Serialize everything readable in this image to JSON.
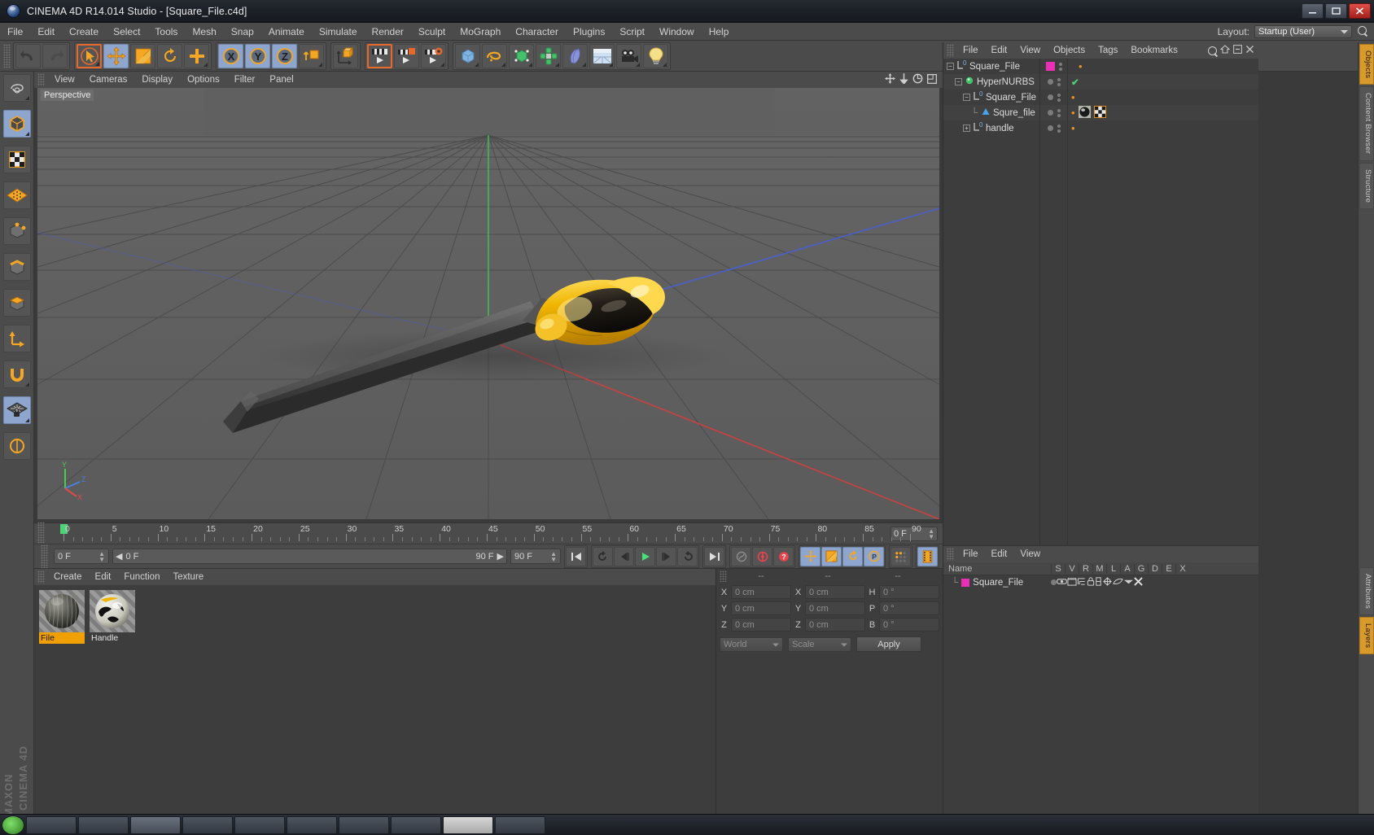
{
  "window": {
    "title": "CINEMA 4D R14.014 Studio - [Square_File.c4d]",
    "app_icon": "c4d-logo-icon",
    "buttons": {
      "minimize": "minimize-icon",
      "maximize": "maximize-icon",
      "close": "close-icon"
    }
  },
  "menubar": {
    "items": [
      "File",
      "Edit",
      "Create",
      "Select",
      "Tools",
      "Mesh",
      "Snap",
      "Animate",
      "Simulate",
      "Render",
      "Sculpt",
      "MoGraph",
      "Character",
      "Plugins",
      "Script",
      "Window",
      "Help"
    ],
    "layout_label": "Layout:",
    "layout_value": "Startup (User)",
    "search_icon": "search-icon"
  },
  "toolbar": {
    "undo": "undo-icon",
    "redo": "redo-icon",
    "groups": [
      {
        "name": "transform-tools",
        "buttons": [
          {
            "icon": "selection-arrow-icon",
            "state": "selected"
          },
          {
            "icon": "move-tool-icon",
            "state": "active"
          },
          {
            "icon": "scale-tool-icon",
            "state": "normal"
          },
          {
            "icon": "rotate-tool-icon",
            "state": "normal"
          },
          {
            "icon": "add-move-icon",
            "state": "normal"
          }
        ]
      },
      {
        "name": "axis-locks",
        "buttons": [
          {
            "icon": "x-axis-icon",
            "state": "active"
          },
          {
            "icon": "y-axis-icon",
            "state": "active"
          },
          {
            "icon": "z-axis-icon",
            "state": "active"
          },
          {
            "icon": "world-object-axis-icon",
            "state": "active"
          }
        ]
      },
      {
        "name": "coordinate-system",
        "buttons": [
          {
            "icon": "object-axis-icon",
            "state": "normal"
          }
        ]
      },
      {
        "name": "render-tools",
        "buttons": [
          {
            "icon": "render-view-icon",
            "state": "selected"
          },
          {
            "icon": "render-region-icon",
            "state": "normal"
          },
          {
            "icon": "render-settings-icon",
            "state": "normal"
          }
        ]
      },
      {
        "name": "object-tools",
        "buttons": [
          {
            "icon": "cube-primitive-icon",
            "state": "normal"
          },
          {
            "icon": "spline-pen-icon",
            "state": "normal"
          },
          {
            "icon": "hypernurbs-icon",
            "state": "normal"
          },
          {
            "icon": "array-generator-icon",
            "state": "normal"
          },
          {
            "icon": "bend-deformer-icon",
            "state": "normal"
          },
          {
            "icon": "floor-environment-icon",
            "state": "normal"
          },
          {
            "icon": "camera-icon",
            "state": "normal"
          },
          {
            "icon": "light-icon",
            "state": "normal"
          }
        ]
      }
    ]
  },
  "left_palette": {
    "items": [
      {
        "icon": "live-selection-icon",
        "state": "normal"
      },
      {
        "icon": "model-mode-icon",
        "state": "active"
      },
      {
        "icon": "texture-mode-icon",
        "state": "normal"
      },
      {
        "icon": "workplane-icon",
        "state": "normal"
      },
      {
        "icon": "points-mode-icon",
        "state": "normal"
      },
      {
        "icon": "edges-mode-icon",
        "state": "normal"
      },
      {
        "icon": "polygons-mode-icon",
        "state": "normal"
      },
      {
        "icon": "object-axis-mode-icon",
        "state": "normal"
      },
      {
        "icon": "enable-snapping-icon",
        "state": "normal"
      },
      {
        "icon": "workplane-lock-icon",
        "state": "active"
      },
      {
        "icon": "viewport-solo-icon",
        "state": "normal"
      }
    ],
    "branding_line1": "MAXON",
    "branding_line2": "CINEMA 4D"
  },
  "viewport": {
    "menu_items": [
      "View",
      "Cameras",
      "Display",
      "Options",
      "Filter",
      "Panel"
    ],
    "nav_icons": [
      "pan-view-icon",
      "dolly-view-icon",
      "orbit-view-icon",
      "maximize-view-icon"
    ],
    "label": "Perspective",
    "axis_labels": {
      "x": "X",
      "y": "Y",
      "z": "Z"
    },
    "scene_description": "3D viewport with grey ground grid, red X axis line, blue Z axis line, green Y axis line, and a yellow-and-black handled square file (metal file tool) model resting on the grid"
  },
  "timeline": {
    "start_frame_field": "0 F",
    "ticks": [
      0,
      5,
      10,
      15,
      20,
      25,
      30,
      35,
      40,
      45,
      50,
      55,
      60,
      65,
      70,
      75,
      80,
      85,
      90
    ],
    "end_field": "0 F",
    "playhead_frame": 0
  },
  "transport": {
    "current_frame": "0 F",
    "range_start": "0 F",
    "range_end": "90 F",
    "max_frame": "90 F",
    "buttons": [
      {
        "name": "go-to-start-button",
        "icon": "skip-start-icon"
      },
      {
        "name": "previous-key-button",
        "icon": "prev-key-icon"
      },
      {
        "name": "step-back-button",
        "icon": "step-back-icon"
      },
      {
        "name": "play-button",
        "icon": "play-icon"
      },
      {
        "name": "step-forward-button",
        "icon": "step-forward-icon"
      },
      {
        "name": "next-key-button",
        "icon": "next-key-icon"
      },
      {
        "name": "go-to-end-button",
        "icon": "skip-end-icon"
      },
      {
        "name": "autokey-button",
        "icon": "autokeying-icon"
      },
      {
        "name": "record-button",
        "icon": "record-active-objects-icon"
      },
      {
        "name": "record-question-button",
        "icon": "record-help-icon"
      }
    ],
    "record_toggles": [
      {
        "name": "key-position-button",
        "icon": "key-position-icon",
        "state": "active"
      },
      {
        "name": "key-scale-button",
        "icon": "key-scale-icon",
        "state": "active"
      },
      {
        "name": "key-rotation-button",
        "icon": "key-rotation-icon",
        "state": "active"
      },
      {
        "name": "key-parameter-button",
        "icon": "key-parameter-icon",
        "state": "active"
      },
      {
        "name": "key-pla-button",
        "icon": "point-level-animation-icon",
        "state": "normal"
      },
      {
        "name": "timeline-filmstrip-button",
        "icon": "filmstrip-icon",
        "state": "active"
      }
    ]
  },
  "material_manager": {
    "menu_items": [
      "Create",
      "Edit",
      "Function",
      "Texture"
    ],
    "materials": [
      {
        "name": "File",
        "selected": true,
        "icon": "material-sphere-dark-ribbed-icon"
      },
      {
        "name": "Handle",
        "selected": false,
        "icon": "material-sphere-yellow-black-icon"
      }
    ]
  },
  "coordinates": {
    "col_headers": [
      "--",
      "--",
      "--"
    ],
    "rows": [
      {
        "l1": "X",
        "v1": "0 cm",
        "l2": "X",
        "v2": "0 cm",
        "l3": "H",
        "v3": "0 °"
      },
      {
        "l1": "Y",
        "v1": "0 cm",
        "l2": "Y",
        "v2": "0 cm",
        "l3": "P",
        "v3": "0 °"
      },
      {
        "l1": "Z",
        "v1": "0 cm",
        "l2": "Z",
        "v2": "0 cm",
        "l3": "B",
        "v3": "0 °"
      }
    ],
    "system": "World",
    "mode": "Scale",
    "apply": "Apply"
  },
  "object_manager": {
    "menu_items": [
      "File",
      "Edit",
      "View",
      "Objects",
      "Tags",
      "Bookmarks"
    ],
    "top_icons": [
      "search-icon",
      "home-icon",
      "collapse-icon",
      "close-icon"
    ],
    "rows": [
      {
        "name": "Square_File",
        "depth": 0,
        "icon": "null-object-icon",
        "has_expand": true,
        "swatch": "#ea2fb5",
        "check": false,
        "tags": []
      },
      {
        "name": "HyperNURBS",
        "depth": 1,
        "icon": "hypernurbs-icon",
        "has_expand": true,
        "swatch": null,
        "check": true,
        "tags": []
      },
      {
        "name": "Square_File",
        "depth": 2,
        "icon": "null-object-icon",
        "has_expand": true,
        "swatch": null,
        "check": false,
        "tags": []
      },
      {
        "name": "Squre_file",
        "depth": 3,
        "icon": "polygon-object-icon",
        "has_expand": false,
        "swatch": null,
        "check": false,
        "tags": [
          "material-tag-icon",
          "uvw-tag-icon"
        ]
      },
      {
        "name": "handle",
        "depth": 2,
        "icon": "null-object-icon",
        "has_expand": true,
        "swatch": null,
        "check": false,
        "tags": []
      }
    ]
  },
  "layers_panel": {
    "menu_items": [
      "File",
      "Edit",
      "View"
    ],
    "columns": [
      "Name",
      "S",
      "V",
      "R",
      "M",
      "L",
      "A",
      "G",
      "D",
      "E",
      "X"
    ],
    "rows": [
      {
        "name": "Square_File",
        "swatch": "#ea2fb5",
        "icons": [
          "solo-icon",
          "view-icon",
          "render-icon",
          "manager-icon",
          "lock-icon",
          "animation-icon",
          "generator-icon",
          "deformer-icon",
          "expression-icon",
          "xpresso-icon"
        ]
      }
    ]
  },
  "edge_tabs": [
    {
      "label": "Objects",
      "highlight": true
    },
    {
      "label": "Content Browser",
      "highlight": false
    },
    {
      "label": "Structure",
      "highlight": false
    },
    {
      "label": "Attributes",
      "highlight": false
    },
    {
      "label": "Layers",
      "highlight": true
    }
  ]
}
